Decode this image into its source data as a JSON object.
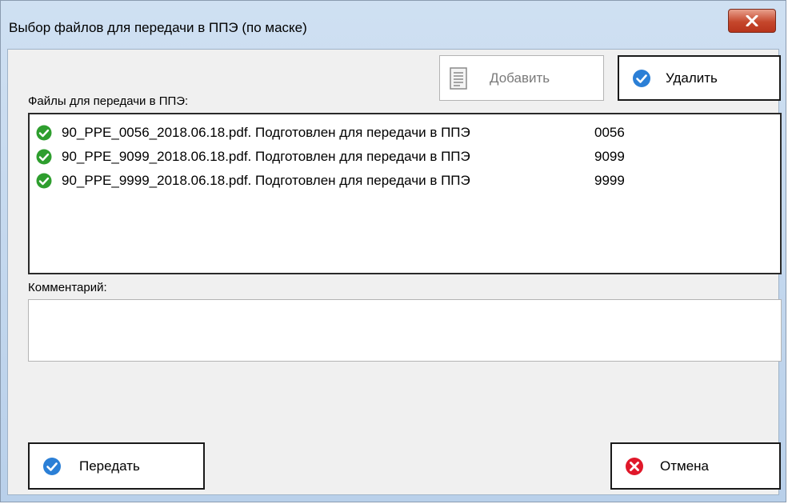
{
  "window": {
    "title": "Выбор файлов для передачи в ППЭ (по маске)"
  },
  "buttons": {
    "add_label": "Добавить",
    "delete_label": "Удалить",
    "send_label": "Передать",
    "cancel_label": "Отмена"
  },
  "files_section": {
    "label": "Файлы для передачи в ППЭ:",
    "items": [
      {
        "name": "90_PPE_0056_2018.06.18.pdf. Подготовлен для передачи в ППЭ",
        "code": "0056",
        "status_icon": "check-circle-icon"
      },
      {
        "name": "90_PPE_9099_2018.06.18.pdf. Подготовлен для передачи в ППЭ",
        "code": "9099",
        "status_icon": "check-circle-icon"
      },
      {
        "name": "90_PPE_9999_2018.06.18.pdf. Подготовлен для передачи в ППЭ",
        "code": "9999",
        "status_icon": "check-circle-icon"
      }
    ]
  },
  "comment_section": {
    "label": "Комментарий:",
    "value": ""
  },
  "colors": {
    "check_green": "#2e9e2e",
    "check_blue": "#2b7fd6",
    "cancel_red": "#e0182a",
    "close_red": "#c5472c"
  }
}
